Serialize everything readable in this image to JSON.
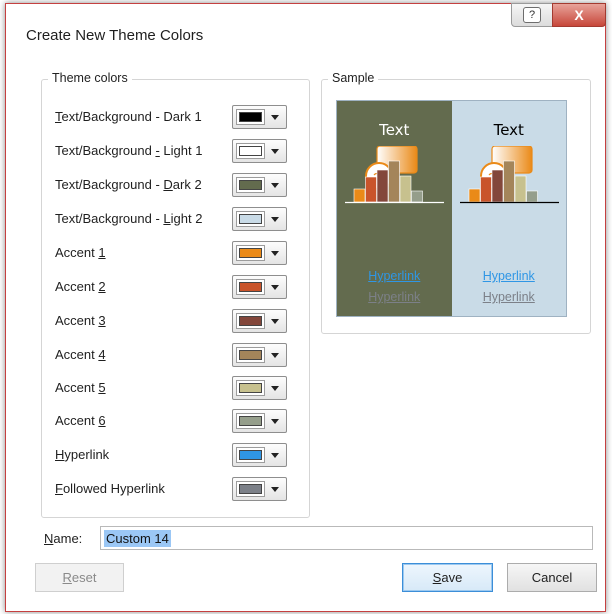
{
  "window": {
    "title": "Create New Theme Colors",
    "help_label": "?",
    "close_label": "X"
  },
  "theme_colors": {
    "legend": "Theme colors",
    "rows": [
      {
        "label": "Text/Background - Dark 1",
        "color": "#000000"
      },
      {
        "label": "Text/Background - Light 1",
        "color": "#ffffff"
      },
      {
        "label": "Text/Background - Dark 2",
        "color": "#636b4e"
      },
      {
        "label": "Text/Background - Light 2",
        "color": "#c9dbe7"
      },
      {
        "label": "Accent 1",
        "color": "#ea8a18"
      },
      {
        "label": "Accent 2",
        "color": "#c9542b"
      },
      {
        "label": "Accent 3",
        "color": "#83473b"
      },
      {
        "label": "Accent 4",
        "color": "#a4855a"
      },
      {
        "label": "Accent 5",
        "color": "#c7c18e"
      },
      {
        "label": "Accent 6",
        "color": "#959e8b"
      },
      {
        "label": "Hyperlink",
        "color": "#2f96e5"
      },
      {
        "label": "Followed Hyperlink",
        "color": "#7c8088"
      }
    ]
  },
  "sample": {
    "legend": "Sample",
    "text_label": "Text",
    "hyperlink_label": "Hyperlink",
    "followed_hyperlink_label": "Hyperlink",
    "dark_background": "#636b4e",
    "light_background": "#c9dbe7",
    "dark_text_color": "#ffffff",
    "light_text_color": "#000000"
  },
  "name": {
    "label": "Name:",
    "value": "Custom 14"
  },
  "buttons": {
    "reset": "Reset",
    "save": "Save",
    "cancel": "Cancel"
  }
}
